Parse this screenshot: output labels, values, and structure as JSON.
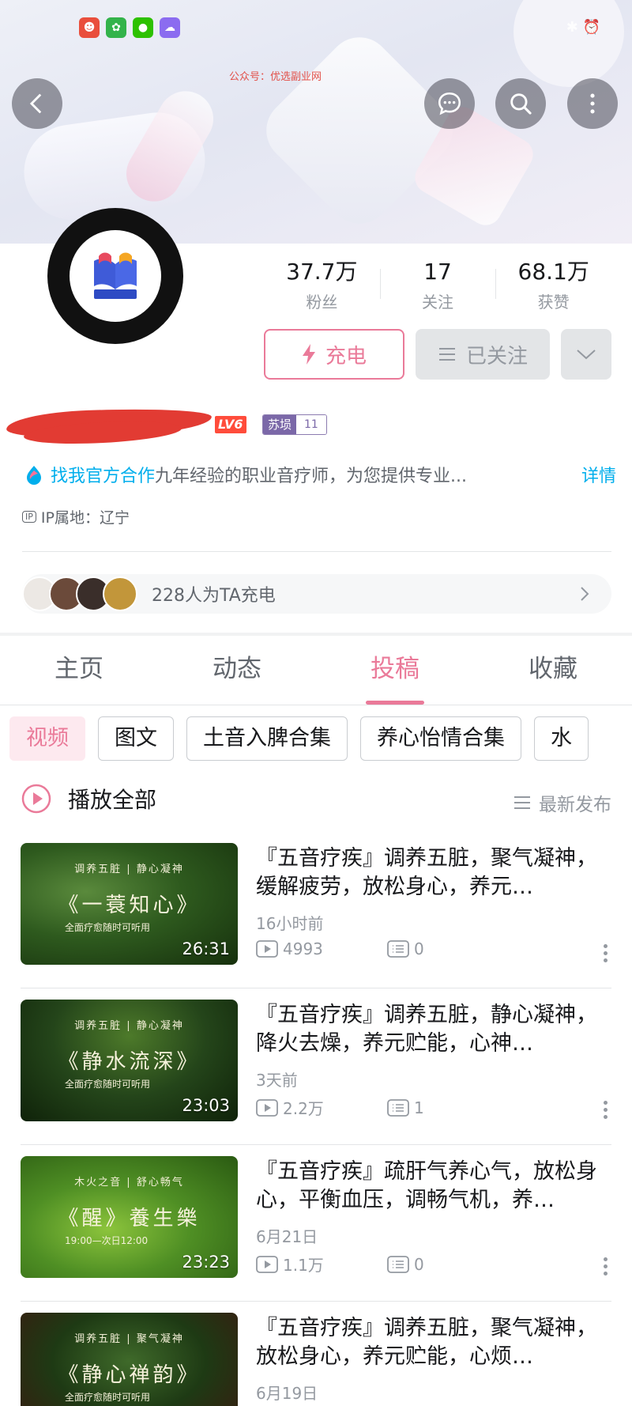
{
  "watermark": "公众号：优选副业网",
  "stats": [
    {
      "value": "37.7万",
      "label": "粉丝"
    },
    {
      "value": "17",
      "label": "关注"
    },
    {
      "value": "68.1万",
      "label": "获赞"
    }
  ],
  "buttons": {
    "charge": "充电",
    "followed": "已关注"
  },
  "profile": {
    "level": "LV6",
    "medal_name": "苏埙",
    "medal_level": "11",
    "bio_link": "找我官方合作",
    "bio_text": "九年经验的职业音疗师，为您提供专业...",
    "bio_more": "详情",
    "ip": "IP属地：辽宁",
    "charge_text": "228人为TA充电"
  },
  "tabs": [
    "主页",
    "动态",
    "投稿",
    "收藏"
  ],
  "active_tab": 2,
  "chips": [
    "视频",
    "图文",
    "土音入脾合集",
    "养心怡情合集",
    "水"
  ],
  "play_all": "播放全部",
  "sort_label": "最新发布",
  "colors": {
    "accent": "#ea7a99",
    "link": "#00aeec",
    "gray": "#9499a0"
  },
  "videos": [
    {
      "title": "『五音疗疾』调养五脏，聚气凝神，缓解疲劳，放松身心，养元…",
      "time": "16小时前",
      "plays": "4993",
      "comments": "0",
      "duration": "26:31",
      "thumb_top": "调养五脏 | 静心凝神",
      "thumb_title": "《一蓑知心》",
      "thumb_bottom": "全面疗愈随时可听用"
    },
    {
      "title": "『五音疗疾』调养五脏，静心凝神，降火去燥，养元贮能，心神…",
      "time": "3天前",
      "plays": "2.2万",
      "comments": "1",
      "duration": "23:03",
      "thumb_top": "调养五脏 | 静心凝神",
      "thumb_title": "《静水流深》",
      "thumb_bottom": "全面疗愈随时可听用"
    },
    {
      "title": "『五音疗疾』疏肝气养心气，放松身心，平衡血压，调畅气机，养…",
      "time": "6月21日",
      "plays": "1.1万",
      "comments": "0",
      "duration": "23:23",
      "thumb_top": "木火之音 | 舒心畅气",
      "thumb_title": "《醒》養生樂",
      "thumb_bottom": "19:00—次日12:00"
    },
    {
      "title": "『五音疗疾』调养五脏，聚气凝神，放松身心，养元贮能，心烦…",
      "time": "6月19日",
      "plays": "",
      "comments": "",
      "duration": "",
      "thumb_top": "调养五脏 | 聚气凝神",
      "thumb_title": "《静心禅韵》",
      "thumb_bottom": "全面疗愈随时可听用"
    }
  ]
}
